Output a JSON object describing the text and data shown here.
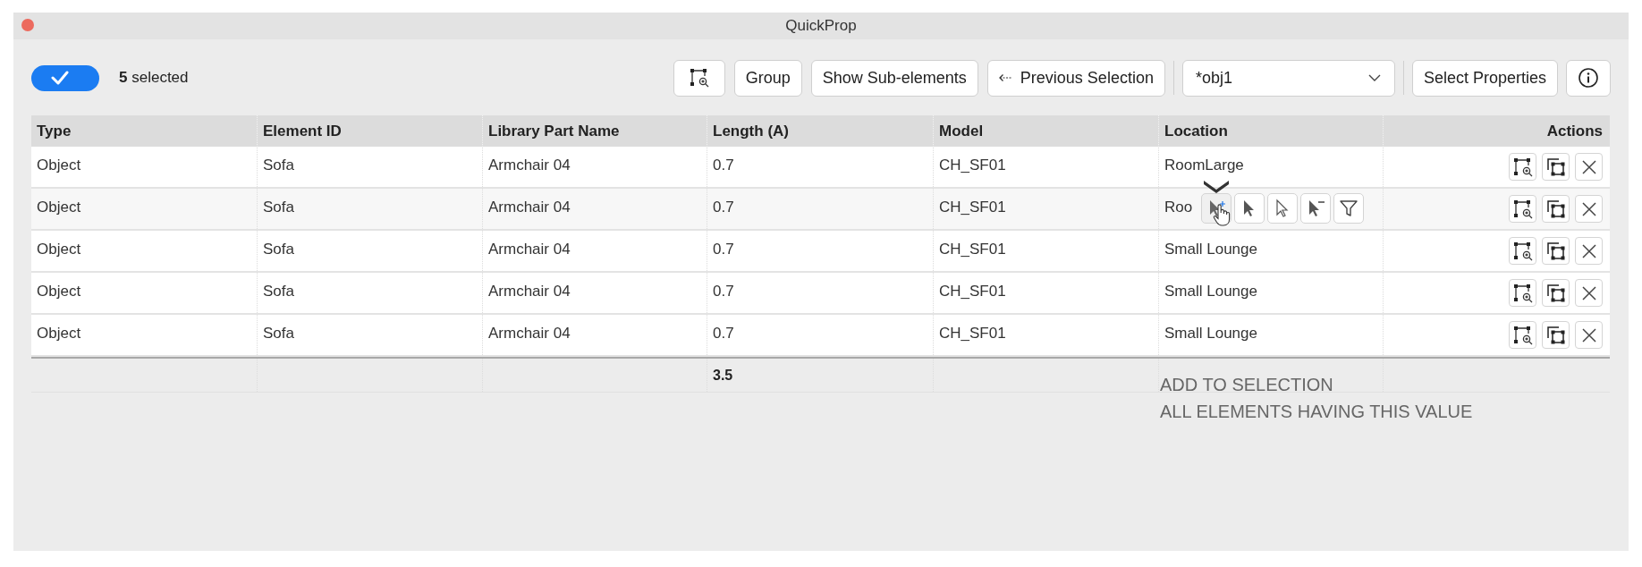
{
  "window": {
    "title": "QuickProp"
  },
  "toolbar": {
    "selection_toggle": {
      "on": true
    },
    "selection_count": "**5** selected",
    "buttons": [
      {
        "kind": "zoom"
      },
      {
        "kind": "text",
        "label": "Group"
      },
      {
        "kind": "text",
        "label": "Show Sub-elements"
      },
      {
        "kind": "back",
        "label": "Previous Selection"
      }
    ],
    "dropdown": {
      "value": "*obj1"
    },
    "properties_button": "Select Properties",
    "info_button": {
      "kind": "info"
    }
  },
  "table": {
    "columns": [
      {
        "label": "Type"
      },
      {
        "label": "Element ID"
      },
      {
        "label": "Library Part Name"
      },
      {
        "label": "Length (A)"
      },
      {
        "label": "Model"
      },
      {
        "label": "Location"
      },
      {
        "label": "Actions"
      }
    ],
    "rows": [
      {
        "hovered": false,
        "cells": [
          "Object",
          "Sofa",
          "Armchair 04",
          "0.7",
          "CH_SF01",
          "RoomLarge"
        ]
      },
      {
        "hovered": true,
        "cells": [
          "Object",
          "Sofa",
          "Armchair 04",
          "0.7",
          "CH_SF01",
          "Roo"
        ]
      },
      {
        "hovered": false,
        "cells": [
          "Object",
          "Sofa",
          "Armchair 04",
          "0.7",
          "CH_SF01",
          "Small Lounge"
        ]
      },
      {
        "hovered": false,
        "cells": [
          "Object",
          "Sofa",
          "Armchair 04",
          "0.7",
          "CH_SF01",
          "Small Lounge"
        ]
      },
      {
        "hovered": false,
        "cells": [
          "Object",
          "Sofa",
          "Armchair 04",
          "0.7",
          "CH_SF01",
          "Small Lounge"
        ]
      }
    ],
    "row_actions": [
      {
        "kind": "zoom"
      },
      {
        "kind": "copy"
      },
      {
        "kind": "remove"
      }
    ],
    "length_total": "3.5"
  },
  "value_popup": {
    "buttons": [
      {
        "kind": "add",
        "hovered": true
      },
      {
        "kind": "select",
        "hovered": false
      },
      {
        "kind": "select_outline",
        "hovered": false
      },
      {
        "kind": "deselect",
        "hovered": false
      },
      {
        "kind": "filter",
        "hovered": false
      }
    ],
    "tooltip": [
      "ADD TO SELECTION",
      "ALL ELEMENTS HAVING THIS VALUE"
    ]
  }
}
